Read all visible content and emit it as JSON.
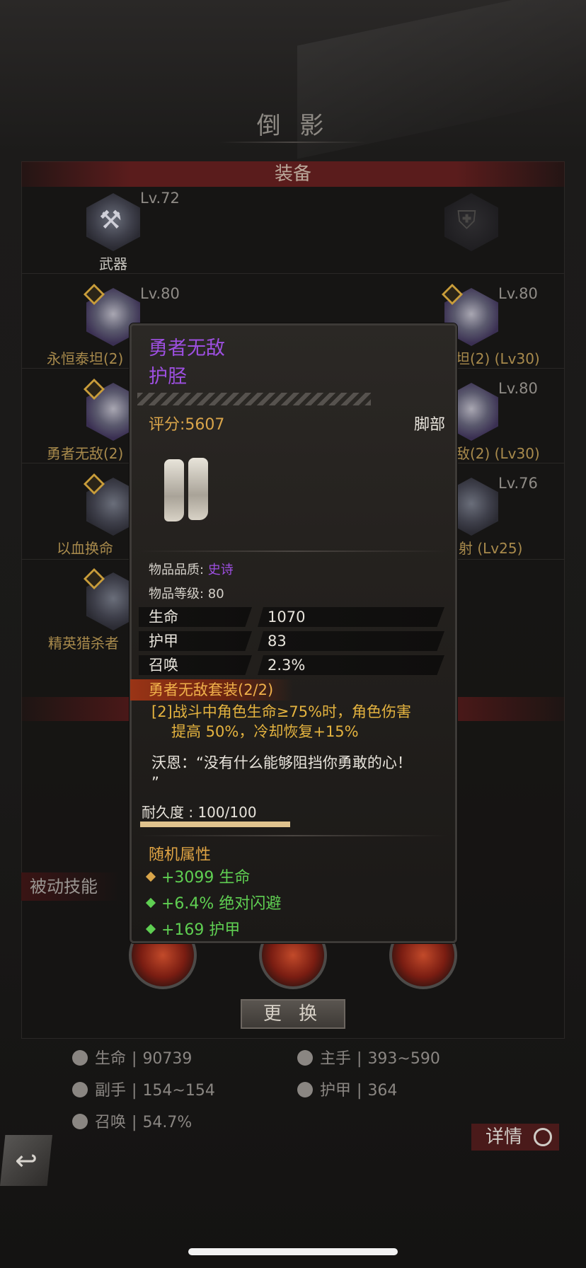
{
  "page": {
    "title": "倒 影",
    "section_equipment": "装备",
    "passive_skills": "被动技能",
    "change_button": "更 换",
    "detail_button": "详情"
  },
  "slots": [
    {
      "label": "武器",
      "level": "Lv.72"
    },
    {
      "label": "",
      "level": ""
    },
    {
      "label": "永恒泰坦(2)",
      "level": "Lv.80"
    },
    {
      "label": "坦(2) (Lv30)",
      "level": "Lv.80"
    },
    {
      "label": "勇者无敌(2)",
      "level": ""
    },
    {
      "label": "敌(2) (Lv30)",
      "level": "Lv.80"
    },
    {
      "label": "以血换命",
      "level": ""
    },
    {
      "label": "射 (Lv25)",
      "level": "Lv.76"
    },
    {
      "label": "精英猎杀者",
      "level": ""
    }
  ],
  "stats": [
    {
      "icon": "heart-icon",
      "name": "生命",
      "value": "90739"
    },
    {
      "icon": "sword-icon",
      "name": "主手",
      "value": "393~590"
    },
    {
      "icon": "offhand-icon",
      "name": "副手",
      "value": "154~154"
    },
    {
      "icon": "shield-icon",
      "name": "护甲",
      "value": "364"
    },
    {
      "icon": "summon-icon",
      "name": "召唤",
      "value": "54.7%"
    }
  ],
  "tooltip": {
    "item_name": "勇者无敌",
    "item_part": "护胫",
    "score": "评分:5607",
    "slot": "脚部",
    "quality_label": "物品品质: ",
    "quality": "史诗",
    "item_level": "物品等级:  80",
    "attributes": [
      {
        "name": "生命",
        "value": "1070"
      },
      {
        "name": "护甲",
        "value": "83"
      },
      {
        "name": "召唤",
        "value": "2.3%"
      }
    ],
    "set_name": "勇者无敌套装(2/2)",
    "set_line1": "[2]战斗中角色生命≥75%时，角色伤害",
    "set_line2": "提高 50%，冷却恢复+15%",
    "quote_line1": "沃恩：“没有什么能够阻挡你勇敢的心！",
    "quote_line2": "”",
    "durability": "耐久度 : 100/100",
    "durability_fraction": 1.0,
    "random_title": "随机属性",
    "random_attrs": [
      {
        "text": "+3099 生命",
        "gem_color": "#d9a54a"
      },
      {
        "text": "+6.4% 绝对闪避",
        "gem_color": "#5fcf52"
      },
      {
        "text": "+169 护甲",
        "gem_color": "#5fcf52"
      }
    ]
  },
  "colors": {
    "epic": "#9d4fe0",
    "gold": "#d9a54a",
    "green": "#5fcf52"
  }
}
